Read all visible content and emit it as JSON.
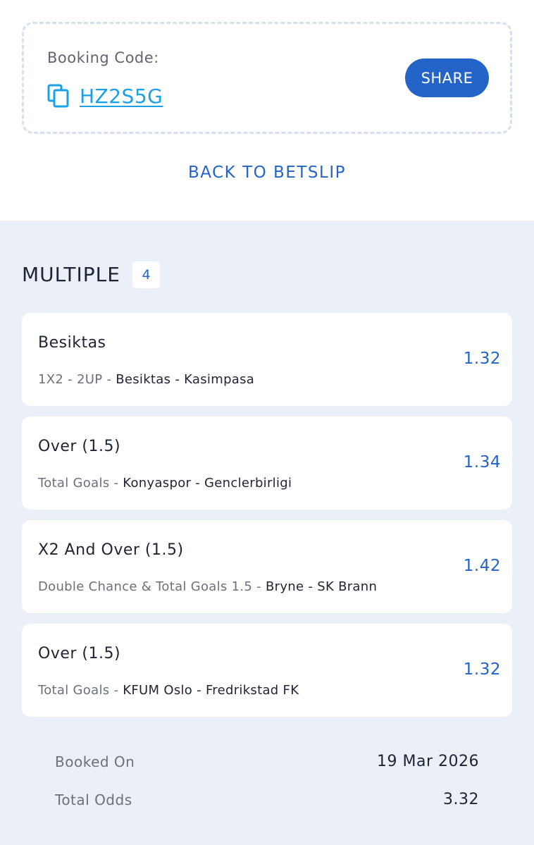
{
  "booking": {
    "label": "Booking Code:",
    "code": "HZ2S5G",
    "copy_icon": "copy-icon",
    "share_label": "SHARE"
  },
  "back_link": "BACK TO BETSLIP",
  "betslip": {
    "title": "MULTIPLE",
    "count": "4",
    "bets": [
      {
        "selection": "Besiktas",
        "market": "1X2 - 2UP",
        "match": "Besiktas - Kasimpasa",
        "odds": "1.32"
      },
      {
        "selection": "Over (1.5)",
        "market": "Total Goals",
        "match": "Konyaspor - Genclerbirligi",
        "odds": "1.34"
      },
      {
        "selection": "X2 And Over (1.5)",
        "market": "Double Chance & Total Goals 1.5",
        "match": "Bryne - SK Brann",
        "odds": "1.42"
      },
      {
        "selection": "Over (1.5)",
        "market": "Total Goals",
        "match": "KFUM Oslo - Fredrikstad FK",
        "odds": "1.32"
      }
    ]
  },
  "summary": {
    "booked_on_label": "Booked On",
    "booked_on_value": "19 Mar 2026",
    "total_odds_label": "Total Odds",
    "total_odds_value": "3.32"
  },
  "colors": {
    "accent": "#2463c8",
    "code_link": "#1aa0e6",
    "panel_background": "#eaeff8",
    "card_background": "#ffffff"
  }
}
